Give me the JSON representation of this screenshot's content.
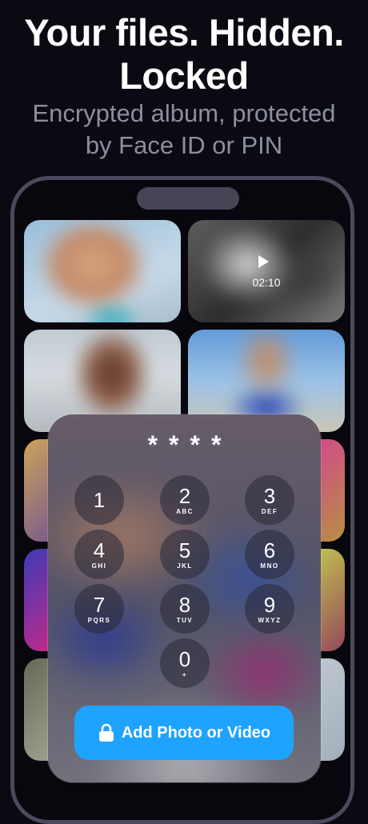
{
  "headline": {
    "line1": "Your files. Hidden.",
    "line2": "Locked"
  },
  "subline": {
    "line1": "Encrypted album, protected",
    "line2": "by Face ID or PIN"
  },
  "gallery": {
    "video_duration": "02:10"
  },
  "lock": {
    "pin_display": "****",
    "keys": [
      {
        "num": "1",
        "letters": ""
      },
      {
        "num": "2",
        "letters": "ABC"
      },
      {
        "num": "3",
        "letters": "DEF"
      },
      {
        "num": "4",
        "letters": "GHI"
      },
      {
        "num": "5",
        "letters": "JKL"
      },
      {
        "num": "6",
        "letters": "MNO"
      },
      {
        "num": "7",
        "letters": "PQRS"
      },
      {
        "num": "8",
        "letters": "TUV"
      },
      {
        "num": "9",
        "letters": "WXYZ"
      },
      {
        "num": "0",
        "letters": "+"
      }
    ],
    "add_button_label": "Add Photo or Video"
  },
  "colors": {
    "accent": "#1ea3ff",
    "background": "#0a0a12",
    "subtext": "#8e8ea0"
  }
}
